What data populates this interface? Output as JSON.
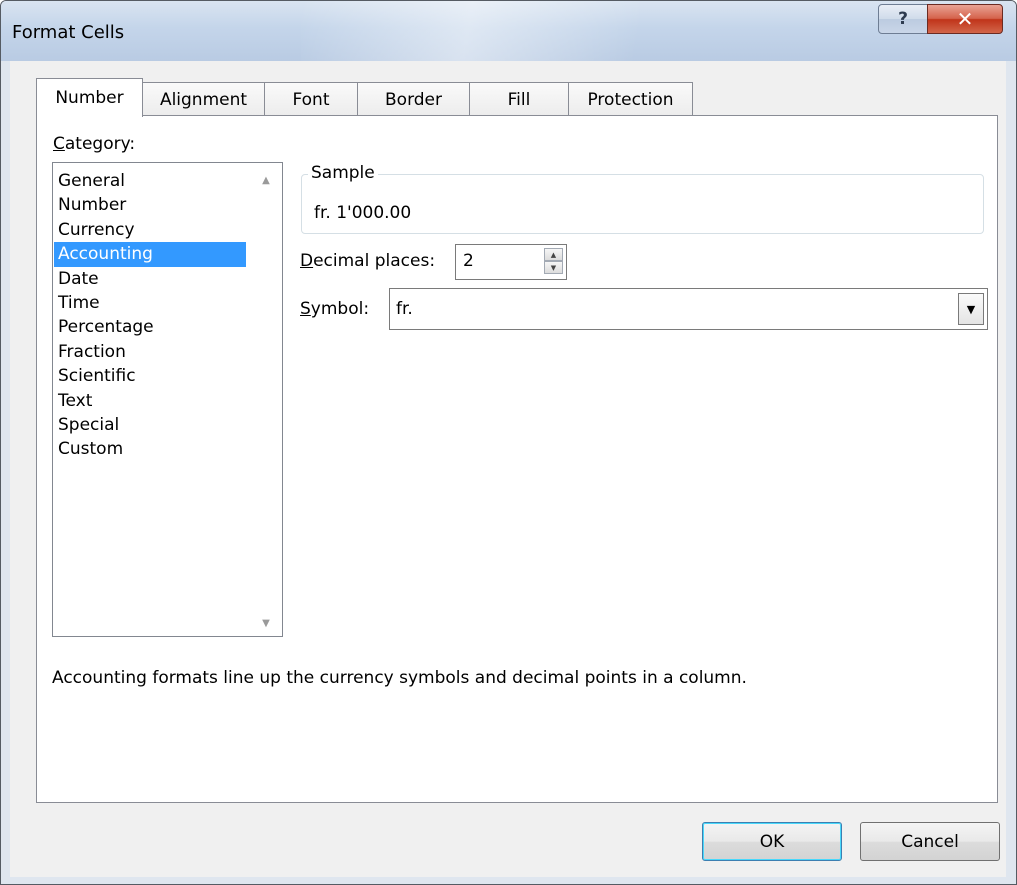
{
  "window": {
    "title": "Format Cells"
  },
  "caption": {
    "help_glyph": "?",
    "close_glyph": "✕"
  },
  "tabs": [
    {
      "label": "Number"
    },
    {
      "label": "Alignment"
    },
    {
      "label": "Font"
    },
    {
      "label": "Border"
    },
    {
      "label": "Fill"
    },
    {
      "label": "Protection"
    }
  ],
  "active_tab": "Number",
  "category": {
    "label_first": "C",
    "label_rest": "ategory:",
    "items": [
      "General",
      "Number",
      "Currency",
      "Accounting",
      "Date",
      "Time",
      "Percentage",
      "Fraction",
      "Scientific",
      "Text",
      "Special",
      "Custom"
    ],
    "selected": "Accounting"
  },
  "sample": {
    "legend": "Sample",
    "value": "fr. 1'000.00"
  },
  "decimal": {
    "label_first": "D",
    "label_rest": "ecimal places:",
    "value": "2"
  },
  "symbol": {
    "label_first": "S",
    "label_rest": "ymbol:",
    "value": "fr."
  },
  "description": "Accounting formats line up the currency symbols and decimal points in a column.",
  "buttons": {
    "ok": "OK",
    "cancel": "Cancel"
  },
  "colors": {
    "selection": "#3399ff",
    "titlebar": "#c4d5ea",
    "close": "#c0341a"
  }
}
